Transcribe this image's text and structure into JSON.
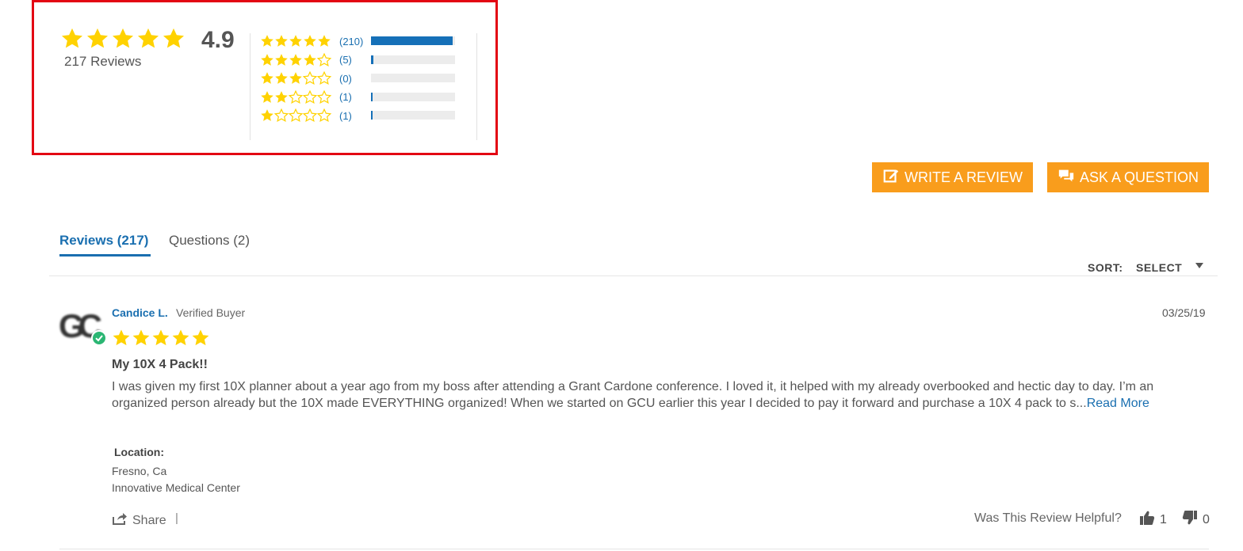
{
  "summary": {
    "average": "4.9",
    "total_reviews": "217 Reviews",
    "rating": 4.9,
    "histogram": [
      {
        "stars": 5,
        "count": "(210)",
        "fraction": 0.97
      },
      {
        "stars": 4,
        "count": "(5)",
        "fraction": 0.03
      },
      {
        "stars": 3,
        "count": "(0)",
        "fraction": 0
      },
      {
        "stars": 2,
        "count": "(1)",
        "fraction": 0.01
      },
      {
        "stars": 1,
        "count": "(1)",
        "fraction": 0.01
      }
    ]
  },
  "actions": {
    "write_review": "WRITE A REVIEW",
    "ask_question": "ASK A QUESTION"
  },
  "tabs": [
    {
      "label": "Reviews (217)",
      "active": true
    },
    {
      "label": "Questions (2)",
      "active": false
    }
  ],
  "sort": {
    "label": "SORT:",
    "value": "SELECT"
  },
  "review": {
    "avatar_initials": "GC",
    "name": "Candice L.",
    "badge": "Verified Buyer",
    "date": "03/25/19",
    "stars": 5,
    "title": "My 10X 4 Pack!!",
    "body": "I was given my first 10X planner about a year ago from my boss after attending a Grant Cardone conference. I loved it, it helped with my already overbooked and hectic day to day. I’m an organized person already but the 10X made EVERYTHING organized! When we started on GCU earlier this year I decided to pay it forward and purchase a 10X 4 pack to s...",
    "read_more": "Read More",
    "location_label": "Location:",
    "location_city": "Fresno, Ca",
    "location_org": "Innovative Medical Center",
    "share_label": "Share",
    "share_separator": "|",
    "helpful_label": "Was This Review Helpful?",
    "helpful_yes": "1",
    "helpful_no": "0"
  },
  "colors": {
    "star": "#ffd200",
    "accent_blue": "#1a6fb0",
    "button_orange": "#f99d1c",
    "highlight_red": "#e30613",
    "verified_green": "#2bb673"
  },
  "icons": {
    "write": "edit-icon",
    "ask": "chat-icon",
    "share": "share-icon",
    "thumbs_up": "thumbs-up-icon",
    "thumbs_down": "thumbs-down-icon",
    "verified": "check-circle-icon"
  }
}
